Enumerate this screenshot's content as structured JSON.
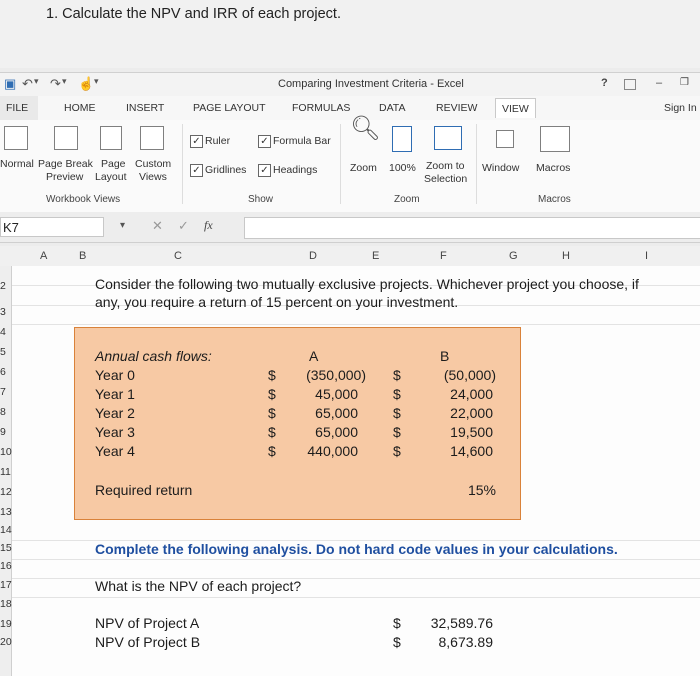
{
  "question": "1. Calculate the NPV and IRR of each project.",
  "window": {
    "title": "Comparing Investment Criteria - Excel",
    "help": "?",
    "minimize": "–"
  },
  "tabs": [
    "FILE",
    "HOME",
    "INSERT",
    "PAGE LAYOUT",
    "FORMULAS",
    "DATA",
    "REVIEW",
    "VIEW"
  ],
  "sign_in": "Sign In",
  "ribbon": {
    "normal": "Normal",
    "page_break_1": "Page Break",
    "page_break_2": "Preview",
    "page_layout_1": "Page",
    "page_layout_2": "Layout",
    "custom_1": "Custom",
    "custom_2": "Views",
    "workbook_views": "Workbook Views",
    "ruler": "Ruler",
    "formula_bar": "Formula Bar",
    "gridlines": "Gridlines",
    "headings": "Headings",
    "show": "Show",
    "zoom": "Zoom",
    "zoom_100": "100%",
    "zoom_sel_1": "Zoom to",
    "zoom_sel_2": "Selection",
    "zoom_group": "Zoom",
    "window": "Window",
    "macros": "Macros",
    "macros_group": "Macros"
  },
  "name_box": "K7",
  "fx": "fx",
  "columns": [
    "A",
    "B",
    "C",
    "D",
    "E",
    "F",
    "G",
    "H",
    "I"
  ],
  "rows": [
    "2",
    "3",
    "4",
    "5",
    "6",
    "7",
    "8",
    "9",
    "10",
    "11",
    "12",
    "13",
    "14",
    "15",
    "16",
    "17",
    "18",
    "19",
    "20"
  ],
  "sheet": {
    "intro_1": "Consider the following two mutually exclusive projects. Whichever project you choose, if",
    "intro_2": "any, you require a return of 15 percent on your investment.",
    "cash_flows_label": "Annual cash flows:",
    "project_a": "A",
    "project_b": "B",
    "years": [
      {
        "label": "Year 0",
        "cur_a": "$",
        "a": "(350,000)",
        "cur_b": "$",
        "b": "(50,000)"
      },
      {
        "label": "Year 1",
        "cur_a": "$",
        "a": "45,000",
        "cur_b": "$",
        "b": "24,000"
      },
      {
        "label": "Year 2",
        "cur_a": "$",
        "a": "65,000",
        "cur_b": "$",
        "b": "22,000"
      },
      {
        "label": "Year 3",
        "cur_a": "$",
        "a": "65,000",
        "cur_b": "$",
        "b": "19,500"
      },
      {
        "label": "Year 4",
        "cur_a": "$",
        "a": "440,000",
        "cur_b": "$",
        "b": "14,600"
      }
    ],
    "required_return_label": "Required return",
    "required_return": "15%",
    "instruction": "Complete the following analysis. Do not hard code values in your calculations.",
    "npv_question": "What is the NPV of each project?",
    "npv_a_label": "NPV of Project A",
    "npv_a_cur": "$",
    "npv_a": "32,589.76",
    "npv_b_label": "NPV of Project B",
    "npv_b_cur": "$",
    "npv_b": "8,673.89"
  }
}
